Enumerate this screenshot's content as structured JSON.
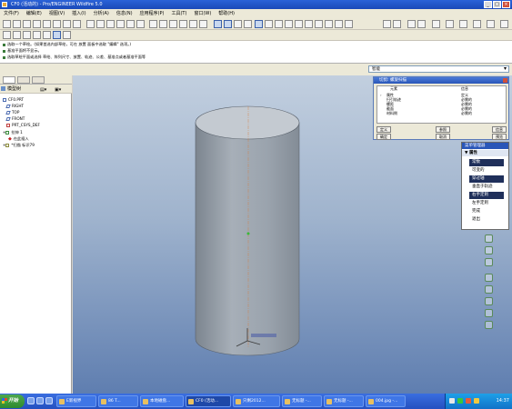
{
  "window": {
    "title": "CF0 (活动的) - Pro/ENGINEER Wildfire 5.0"
  },
  "menubar": {
    "items": [
      "文件(F)",
      "编辑(E)",
      "视图(V)",
      "插入(I)",
      "分析(A)",
      "信息(N)",
      "应用程序(P)",
      "工具(T)",
      "窗口(W)",
      "帮助(H)"
    ]
  },
  "messages": [
    "选取一个草绘。(如果首选内部草绘，可在 放置 面板中选取 \"编辑\" 选项。)",
    "基准平面将不显示。",
    "选取草绘平面或选择 草绘、阵列尺寸、放置、轨迹、公差、基准点或者基准平面等"
  ],
  "filter": {
    "value": "智能"
  },
  "model_tree": {
    "header": "模型树",
    "items": [
      {
        "label": "CF0.PRT",
        "icon": "part-icon"
      },
      {
        "label": "RIGHT",
        "icon": "datum-plane-icon"
      },
      {
        "label": "TOP",
        "icon": "datum-plane-icon"
      },
      {
        "label": "FRONT",
        "icon": "datum-plane-icon"
      },
      {
        "label": "PRT_CSYS_DEF",
        "icon": "csys-icon"
      },
      {
        "label": "拉伸 1",
        "icon": "extrude-icon"
      },
      {
        "label": "在此插入",
        "icon": "insert-here-icon"
      },
      {
        "label": "*扫描 标识79",
        "icon": "sweep-icon"
      }
    ]
  },
  "dialog": {
    "title": "切剪: 螺旋扫描",
    "col_element": "元素",
    "col_info": "信息",
    "rows": [
      {
        "element": "属性",
        "info": "定义"
      },
      {
        "element": "扫引轨迹",
        "info": "必需的"
      },
      {
        "element": "螺距",
        "info": "必需的"
      },
      {
        "element": "截面",
        "info": "必需的"
      },
      {
        "element": "材料侧",
        "info": "必需的"
      }
    ],
    "buttons": [
      "定义",
      "参照",
      "信息",
      "确定",
      "取消",
      "预览"
    ]
  },
  "menu_manager": {
    "title": "菜单管理器",
    "section": "属性",
    "items": [
      {
        "label": "常数",
        "selected": true
      },
      {
        "label": "可变的",
        "selected": false
      },
      {
        "label": "穿过轴",
        "selected": true
      },
      {
        "label": "垂直于轨迹",
        "selected": false
      },
      {
        "label": "右手定则",
        "selected": true
      },
      {
        "label": "左手定则",
        "selected": false
      },
      {
        "label": "完成",
        "selected": false
      },
      {
        "label": "退出",
        "selected": false
      }
    ]
  },
  "viewport": {
    "cylinder_color": "#9aa3ad",
    "cylinder_top_color": "#c4cad1"
  },
  "taskbar": {
    "start_label": "开始",
    "tasks": [
      {
        "label": "E新视界",
        "active": false
      },
      {
        "label": "86 T...",
        "active": false
      },
      {
        "label": "本地磁盘...",
        "active": false
      },
      {
        "label": "CF0 (活动...",
        "active": true
      },
      {
        "label": "只剩2012...",
        "active": false
      },
      {
        "label": "无标题 -...",
        "active": false
      },
      {
        "label": "无标题 -...",
        "active": false
      },
      {
        "label": "004.jpg -...",
        "active": false
      }
    ],
    "clock": "14:37"
  }
}
